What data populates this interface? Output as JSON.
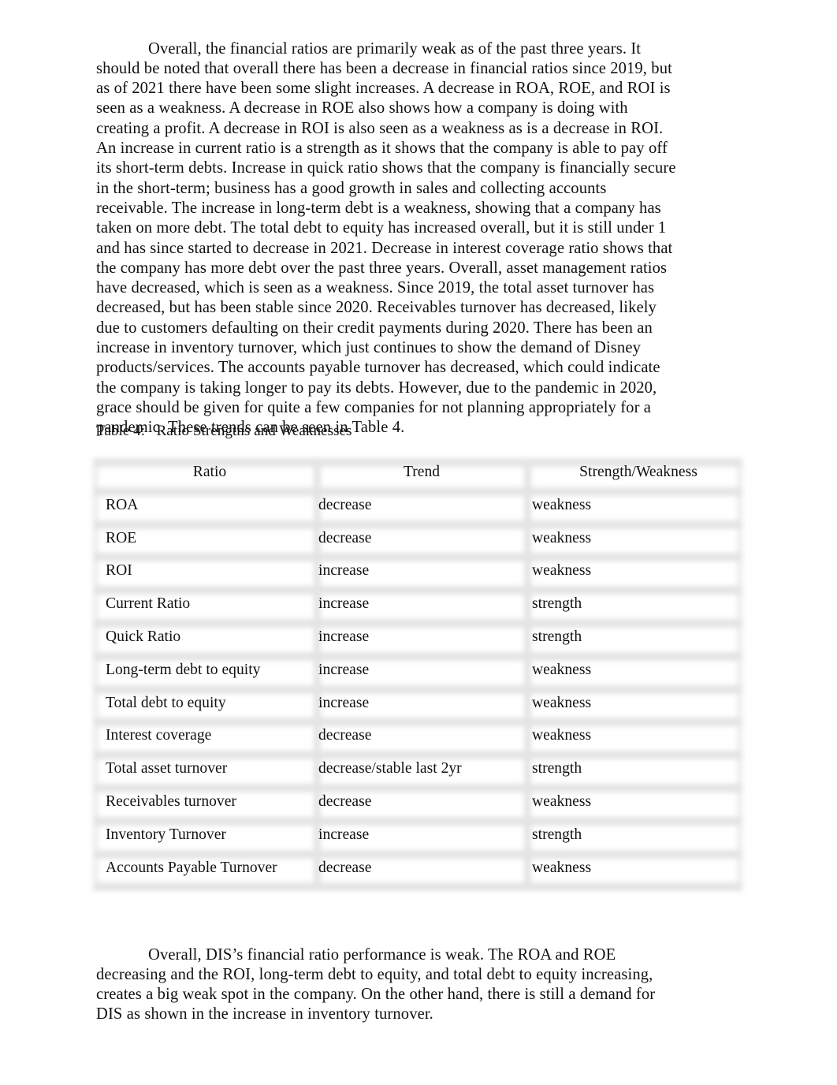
{
  "document": {
    "paragraphs": {
      "intro": "Overall, the financial ratios are primarily weak as of the past three years. It should be noted that overall there has been a decrease in financial ratios since 2019, but as of 2021 there have been some slight increases. A decrease in ROA, ROE, and ROI is seen as a weakness. A decrease in ROE also shows how a company is doing with creating a profit. A decrease in ROI is also seen as a weakness as is a decrease in ROI. An increase in current ratio is a strength as it shows that the company is able to pay off its short-term debts. Increase in quick ratio shows that the company is financially secure in the short-term; business has a good growth in sales and collecting accounts receivable. The increase in long-term debt is a weakness, showing that a company has taken on more debt. The total debt to equity has increased overall, but it is still under 1 and has since started to decrease in 2021. Decrease in interest coverage ratio shows that the company has more debt over the past three years. Overall, asset management ratios have decreased, which is seen as a weakness. Since 2019, the total asset turnover has decreased, but has been stable since 2020. Receivables turnover has decreased, likely due to customers defaulting on their credit payments during 2020. There has been an increase in inventory turnover, which just continues to show the demand of Disney products/services. The accounts payable turnover has decreased, which could indicate the company is taking longer to pay its debts. However, due to the pandemic in 2020, grace should be given for quite a few companies for not planning appropriately for a pandemic. These trends can be seen in Table 4.",
      "conclusion": "Overall, DIS’s financial ratio performance is weak. The ROA and ROE decreasing and the ROI, long-term debt to equity, and total debt to equity increasing, creates a big weak spot in the company. On the other hand, there is still a demand for DIS as shown in the increase in inventory turnover."
    },
    "table": {
      "caption": "Table 4:   Ratio Strengths and Weaknesses",
      "headers": [
        "Ratio",
        "Trend",
        "Strength/Weakness"
      ],
      "rows": [
        {
          "ratio": "ROA",
          "trend": "decrease",
          "assessment": "weakness"
        },
        {
          "ratio": "ROE",
          "trend": "decrease",
          "assessment": "weakness"
        },
        {
          "ratio": "ROI",
          "trend": "increase",
          "assessment": "weakness"
        },
        {
          "ratio": "Current Ratio",
          "trend": "increase",
          "assessment": "strength"
        },
        {
          "ratio": "Quick Ratio",
          "trend": "increase",
          "assessment": "strength"
        },
        {
          "ratio": "Long-term debt to equity",
          "trend": "increase",
          "assessment": "weakness"
        },
        {
          "ratio": "Total debt to equity",
          "trend": "increase",
          "assessment": "weakness"
        },
        {
          "ratio": "Interest coverage",
          "trend": "decrease",
          "assessment": "weakness"
        },
        {
          "ratio": "Total asset turnover",
          "trend": "decrease/stable last 2yr",
          "assessment": "strength"
        },
        {
          "ratio": "Receivables turnover",
          "trend": "decrease",
          "assessment": "weakness"
        },
        {
          "ratio": "Inventory Turnover",
          "trend": "increase",
          "assessment": "strength"
        },
        {
          "ratio": "Accounts Payable Turnover",
          "trend": "decrease",
          "assessment": "weakness"
        }
      ]
    },
    "colors": {
      "page_background": "#ffffff",
      "text": "#111111",
      "table_separator": "#e4e4e4"
    }
  }
}
